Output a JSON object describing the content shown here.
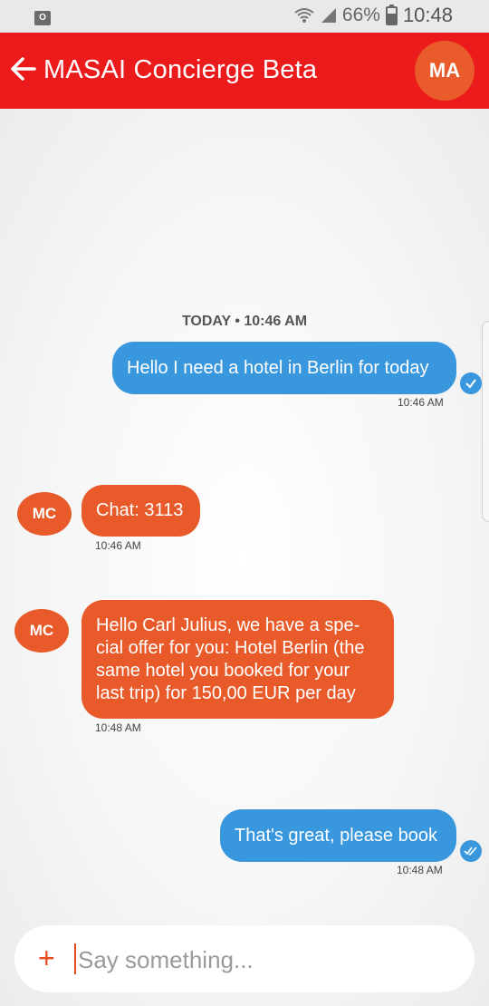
{
  "status_bar": {
    "notification_icon": "outlook-icon",
    "notification_label": "O",
    "battery": "66%",
    "time": "10:48"
  },
  "header": {
    "title": "MASAI Concierge Beta",
    "avatar": "MA",
    "color": "#ec1b1b"
  },
  "chat": {
    "date_divider": "TODAY • 10:46 AM",
    "messages": [
      {
        "sender": "me",
        "text": "Hello  I need a hotel in Berlin for today",
        "time": "10:46 AM",
        "status": "check-icon"
      },
      {
        "sender": "MC",
        "avatar": "MC",
        "text": "Chat: 3113",
        "time": "10:46 AM"
      },
      {
        "sender": "MC",
        "avatar": "MC",
        "lines": [
          "Hello Carl Julius, we have a spe-",
          "cial offer for you: Hotel Berlin (the",
          "same hotel you booked for your",
          "last trip) for 150,00 EUR per day"
        ],
        "time": "10:48 AM"
      },
      {
        "sender": "me",
        "text": "That's great, please book",
        "time": "10:48 AM",
        "status": "double-check-icon"
      }
    ]
  },
  "composer": {
    "add_symbol": "+",
    "placeholder": "Say something..."
  },
  "colors": {
    "outgoing": "#3897dd",
    "incoming": "#e85a29"
  }
}
